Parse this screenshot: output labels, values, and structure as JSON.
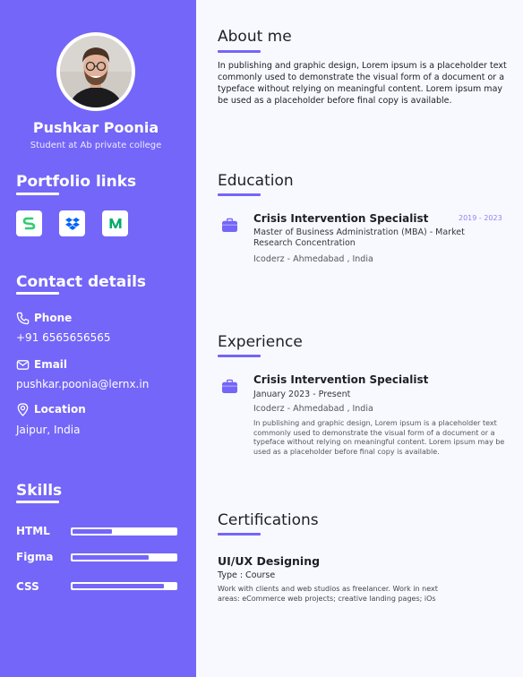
{
  "profile": {
    "name": "Pushkar Poonia",
    "subtitle": "Student at Ab private college"
  },
  "portfolio": {
    "heading": "Portfolio links",
    "links": [
      {
        "icon": "stackshare-icon",
        "color": "#2ecc71"
      },
      {
        "icon": "dropbox-icon",
        "color": "#0061fe"
      },
      {
        "icon": "medium-icon",
        "color": "#00ab6c"
      }
    ]
  },
  "contact": {
    "heading": "Contact details",
    "phone_label": "Phone",
    "phone": "+91 6565656565",
    "email_label": "Email",
    "email": "pushkar.poonia@lernx.in",
    "location_label": "Location",
    "location": "Jaipur, India"
  },
  "skills": {
    "heading": "Skills",
    "items": [
      {
        "name": "HTML",
        "level": 0.38
      },
      {
        "name": "Figma",
        "level": 0.74
      },
      {
        "name": "CSS",
        "level": 0.89
      }
    ]
  },
  "about": {
    "heading": "About me",
    "text": "In publishing and graphic design, Lorem ipsum is a placeholder text commonly used to demonstrate the visual form of a document or a typeface without relying on meaningful content. Lorem ipsum may be used as a placeholder before final copy is available."
  },
  "education": {
    "heading": "Education",
    "title": "Crisis Intervention Specialist",
    "years": "2019 - 2023",
    "degree": "Master of Business Administration (MBA) - Market Research Concentration",
    "location": "Icoderz - Ahmedabad , India"
  },
  "experience": {
    "heading": "Experience",
    "title": "Crisis Intervention Specialist",
    "dates": "January 2023 - Present",
    "location": "Icoderz - Ahmedabad , India",
    "description": "In publishing and graphic design, Lorem ipsum is a placeholder text commonly used to demonstrate the visual form of a document or a typeface without relying on meaningful content. Lorem ipsum may be used as a placeholder before final copy is available."
  },
  "certifications": {
    "heading": "Certifications",
    "title": "UI/UX Designing",
    "type": "Type : Course",
    "description": "Work with clients and web studios as freelancer. Work in next areas: eCommerce web projects; creative landing pages; iOs"
  },
  "colors": {
    "accent": "#7466f8",
    "sidebar_bg": "#7466f8",
    "page_bg": "#f8f9fe"
  }
}
